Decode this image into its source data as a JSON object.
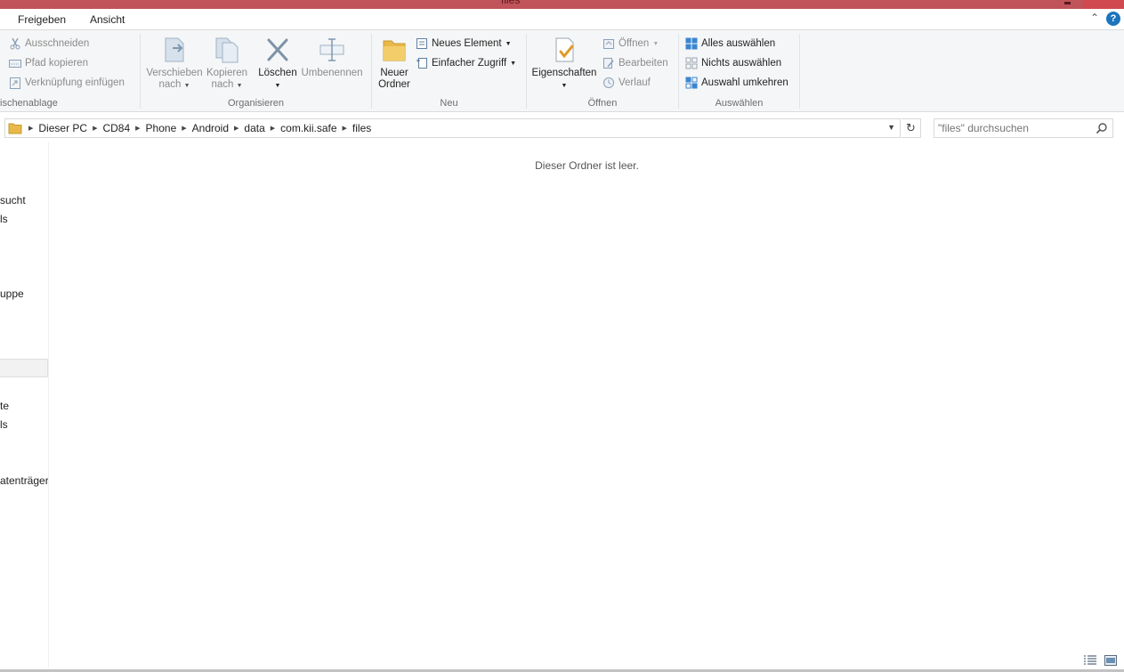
{
  "window": {
    "title": "files"
  },
  "tabs": [
    {
      "label": "Freigeben"
    },
    {
      "label": "Ansicht"
    }
  ],
  "ribbon": {
    "clipboard": {
      "group_label": "ischenablage",
      "items": [
        {
          "label": "Ausschneiden"
        },
        {
          "label": "Pfad kopieren"
        },
        {
          "label": "Verknüpfung einfügen"
        }
      ]
    },
    "organize": {
      "group_label": "Organisieren",
      "move": {
        "line1": "Verschieben",
        "line2": "nach"
      },
      "copy": {
        "line1": "Kopieren",
        "line2": "nach"
      },
      "delete": {
        "label": "Löschen"
      },
      "rename": {
        "label": "Umbenennen"
      }
    },
    "new": {
      "group_label": "Neu",
      "new_folder": {
        "line1": "Neuer",
        "line2": "Ordner"
      },
      "new_item": {
        "label": "Neues Element"
      },
      "easy_access": {
        "label": "Einfacher Zugriff"
      }
    },
    "open": {
      "group_label": "Öffnen",
      "properties": {
        "label": "Eigenschaften"
      },
      "open": {
        "label": "Öffnen"
      },
      "edit": {
        "label": "Bearbeiten"
      },
      "history": {
        "label": "Verlauf"
      }
    },
    "select": {
      "group_label": "Auswählen",
      "select_all": {
        "label": "Alles auswählen"
      },
      "select_none": {
        "label": "Nichts auswählen"
      },
      "invert": {
        "label": "Auswahl umkehren"
      }
    }
  },
  "address": {
    "crumbs": [
      "Dieser PC",
      "CD84",
      "Phone",
      "Android",
      "data",
      "com.kii.safe",
      "files"
    ]
  },
  "search": {
    "placeholder": "\"files\" durchsuchen"
  },
  "nav": {
    "items": [
      {
        "label": "sucht"
      },
      {
        "label": "ls"
      },
      {
        "label": "uppe"
      },
      {
        "label": "te"
      },
      {
        "label": "ls"
      },
      {
        "label": "atenträger"
      }
    ]
  },
  "content": {
    "empty_message": "Dieser Ordner ist leer."
  },
  "colors": {
    "titlebar": "#c0545a",
    "accent": "#1c75bc",
    "folder": "#e8b84a"
  }
}
